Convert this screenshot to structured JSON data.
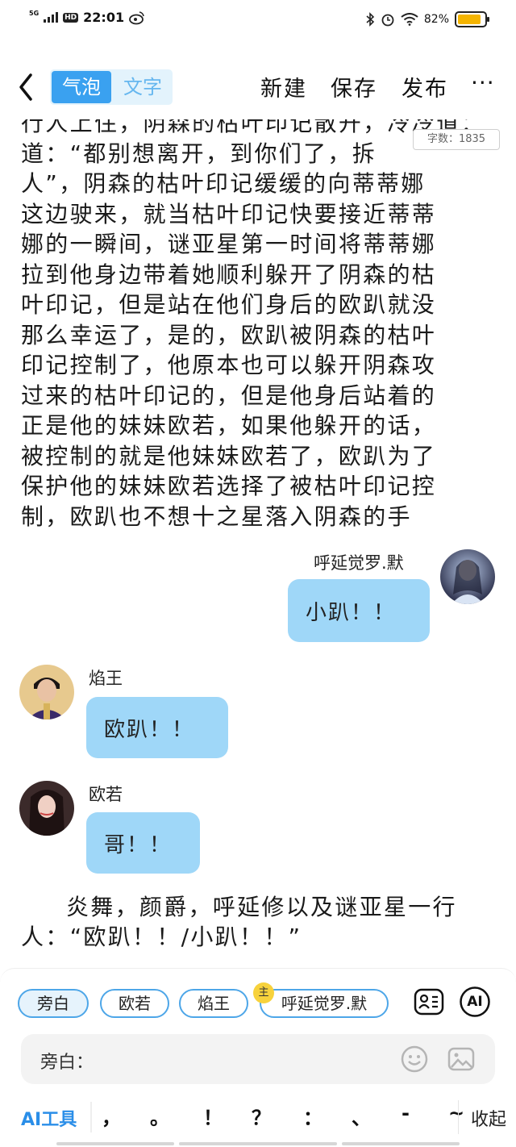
{
  "status_bar": {
    "network": "5G",
    "hd": "HD",
    "time": "22:01",
    "battery": "82%",
    "battery_level": 0.82
  },
  "header": {
    "mode_bubble": "气泡",
    "mode_text": "文字",
    "new_label": "新建",
    "save_label": "保存",
    "publish_label": "发布",
    "more_label": "···"
  },
  "word_count": "字数：1835",
  "story_lines": [
    "行人上住，阴森的枯叶印记散开，冷冷道：",
    "道：“都别想离开，到你们了，拆",
    "人”，阴森的枯叶印记缓缓的向蒂蒂娜",
    "这边驶来，就当枯叶印记快要接近蒂蒂",
    "娜的一瞬间，谜亚星第一时间将蒂蒂娜",
    "拉到他身边带着她顺利躲开了阴森的枯",
    "叶印记，但是站在他们身后的欧趴就没",
    "那么幸运了，是的，欧趴被阴森的枯叶",
    "印记控制了，他原本也可以躲开阴森攻",
    "过来的枯叶印记的，但是他身后站着的",
    "正是他的妹妹欧若，如果他躲开的话，",
    "被控制的就是他妹妹欧若了，欧趴为了",
    "保护他的妹妹欧若选择了被枯叶印记控",
    "制，欧趴也不想十之星落入阴森的手"
  ],
  "messages": [
    {
      "speaker": "呼延觉罗.默",
      "text": "小趴！！",
      "side": "right"
    },
    {
      "speaker": "焰王",
      "text": "欧趴！！",
      "side": "left"
    },
    {
      "speaker": "欧若",
      "text": "哥！！",
      "side": "left"
    }
  ],
  "narration": "炎舞，颜爵，呼延修以及谜亚星一行人：“欧趴！！/小趴！！”",
  "roles": [
    {
      "label": "旁白",
      "selected": true
    },
    {
      "label": "欧若",
      "selected": false
    },
    {
      "label": "焰王",
      "selected": false
    },
    {
      "label": "呼延觉罗.默",
      "selected": false,
      "badge": "主"
    }
  ],
  "ai_badge": "AI",
  "input": {
    "label": "旁白："
  },
  "toolbar": {
    "ai_tools": "AI工具",
    "punctuation": [
      "，",
      "。",
      "！",
      "？",
      "：",
      "、",
      "-",
      "~"
    ],
    "collapse": "收起"
  }
}
